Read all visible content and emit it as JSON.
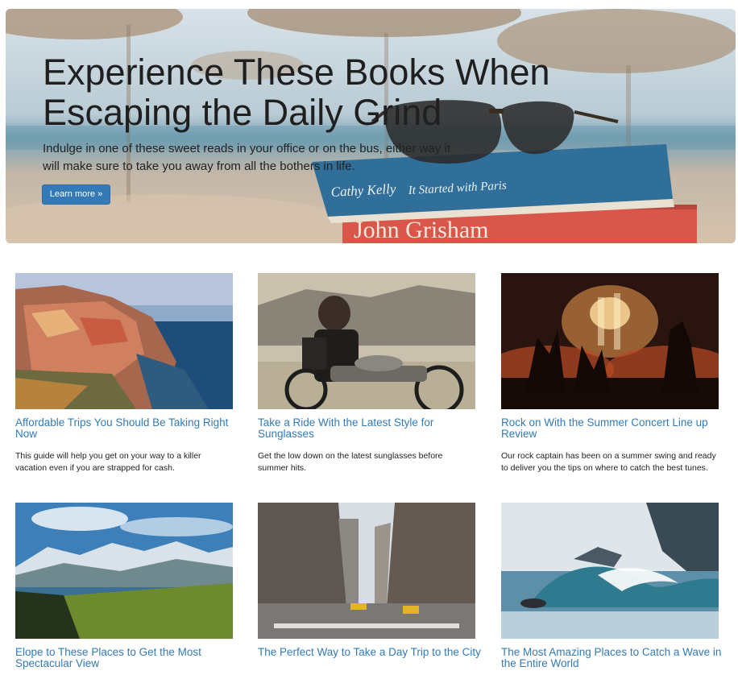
{
  "hero": {
    "title": "Experience These Books When Escaping the Daily Grind",
    "subtitle": "Indulge in one of these sweet reads in your office or on the bus, either way it will make sure to take you away from all the bothers in life.",
    "button_label": "Learn more »",
    "book_top_author": "Cathy Kelly",
    "book_top_title": "It Started with Paris",
    "book_bottom_author": "John Grisham"
  },
  "cards": [
    {
      "title": "Affordable Trips You Should Be Taking Right Now",
      "description": "This guide will help you get on your way to a killer vacation even if you are strapped for cash.",
      "image": "coastal-village-photo"
    },
    {
      "title": "Take a Ride With the Latest Style for Sunglasses",
      "description": "Get the low down on the latest sunglasses before summer hits.",
      "image": "motorcycle-rider-photo"
    },
    {
      "title": "Rock on With the Summer Concert Line up Review",
      "description": "Our rock captain has been on a summer swing and ready to deliver you the tips on where to catch the best tunes.",
      "image": "concert-crowd-photo"
    },
    {
      "title": "Elope to These Places to Get the Most Spectacular View",
      "description": "",
      "image": "mountain-lake-photo"
    },
    {
      "title": "The Perfect Way to Take a Day Trip to the City",
      "description": "",
      "image": "city-street-photo"
    },
    {
      "title": "The Most Amazing Places to Catch a Wave in the Entire World",
      "description": "",
      "image": "ocean-wave-photo"
    }
  ]
}
